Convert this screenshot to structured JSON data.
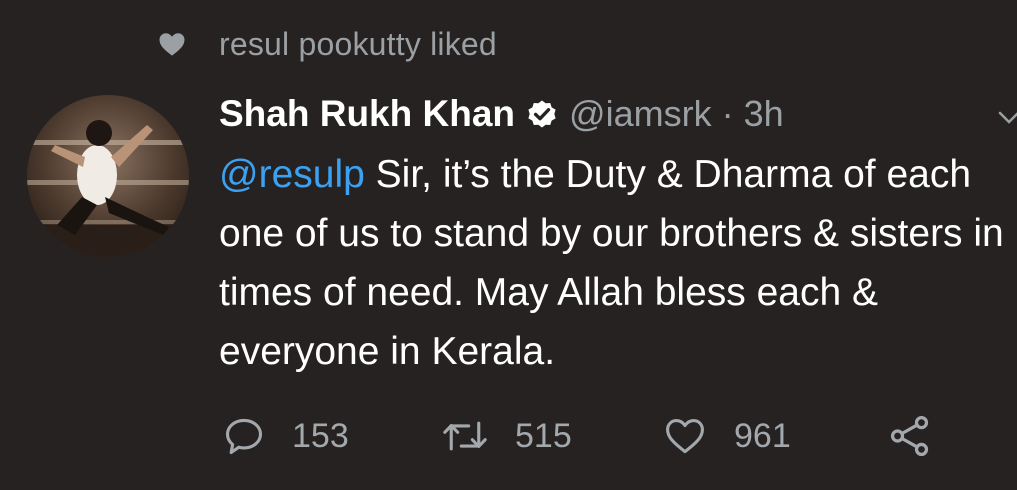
{
  "social_context": {
    "icon": "heart-icon",
    "text": "resul pookutty liked"
  },
  "tweet": {
    "author_name": "Shah Rukh Khan",
    "verified": true,
    "handle": "@iamsrk",
    "separator": "·",
    "time": "3h",
    "mention": "@resulp",
    "body": " Sir, it’s the Duty & Dharma of each one of us to stand by our brothers & sisters in times of need. May Allah bless each & everyone in Kerala.",
    "colors": {
      "background": "#262221",
      "mention": "#3ba1f0",
      "secondary_text": "#9aa0a4"
    }
  },
  "actions": {
    "reply_count": "153",
    "retweet_count": "515",
    "like_count": "961"
  }
}
